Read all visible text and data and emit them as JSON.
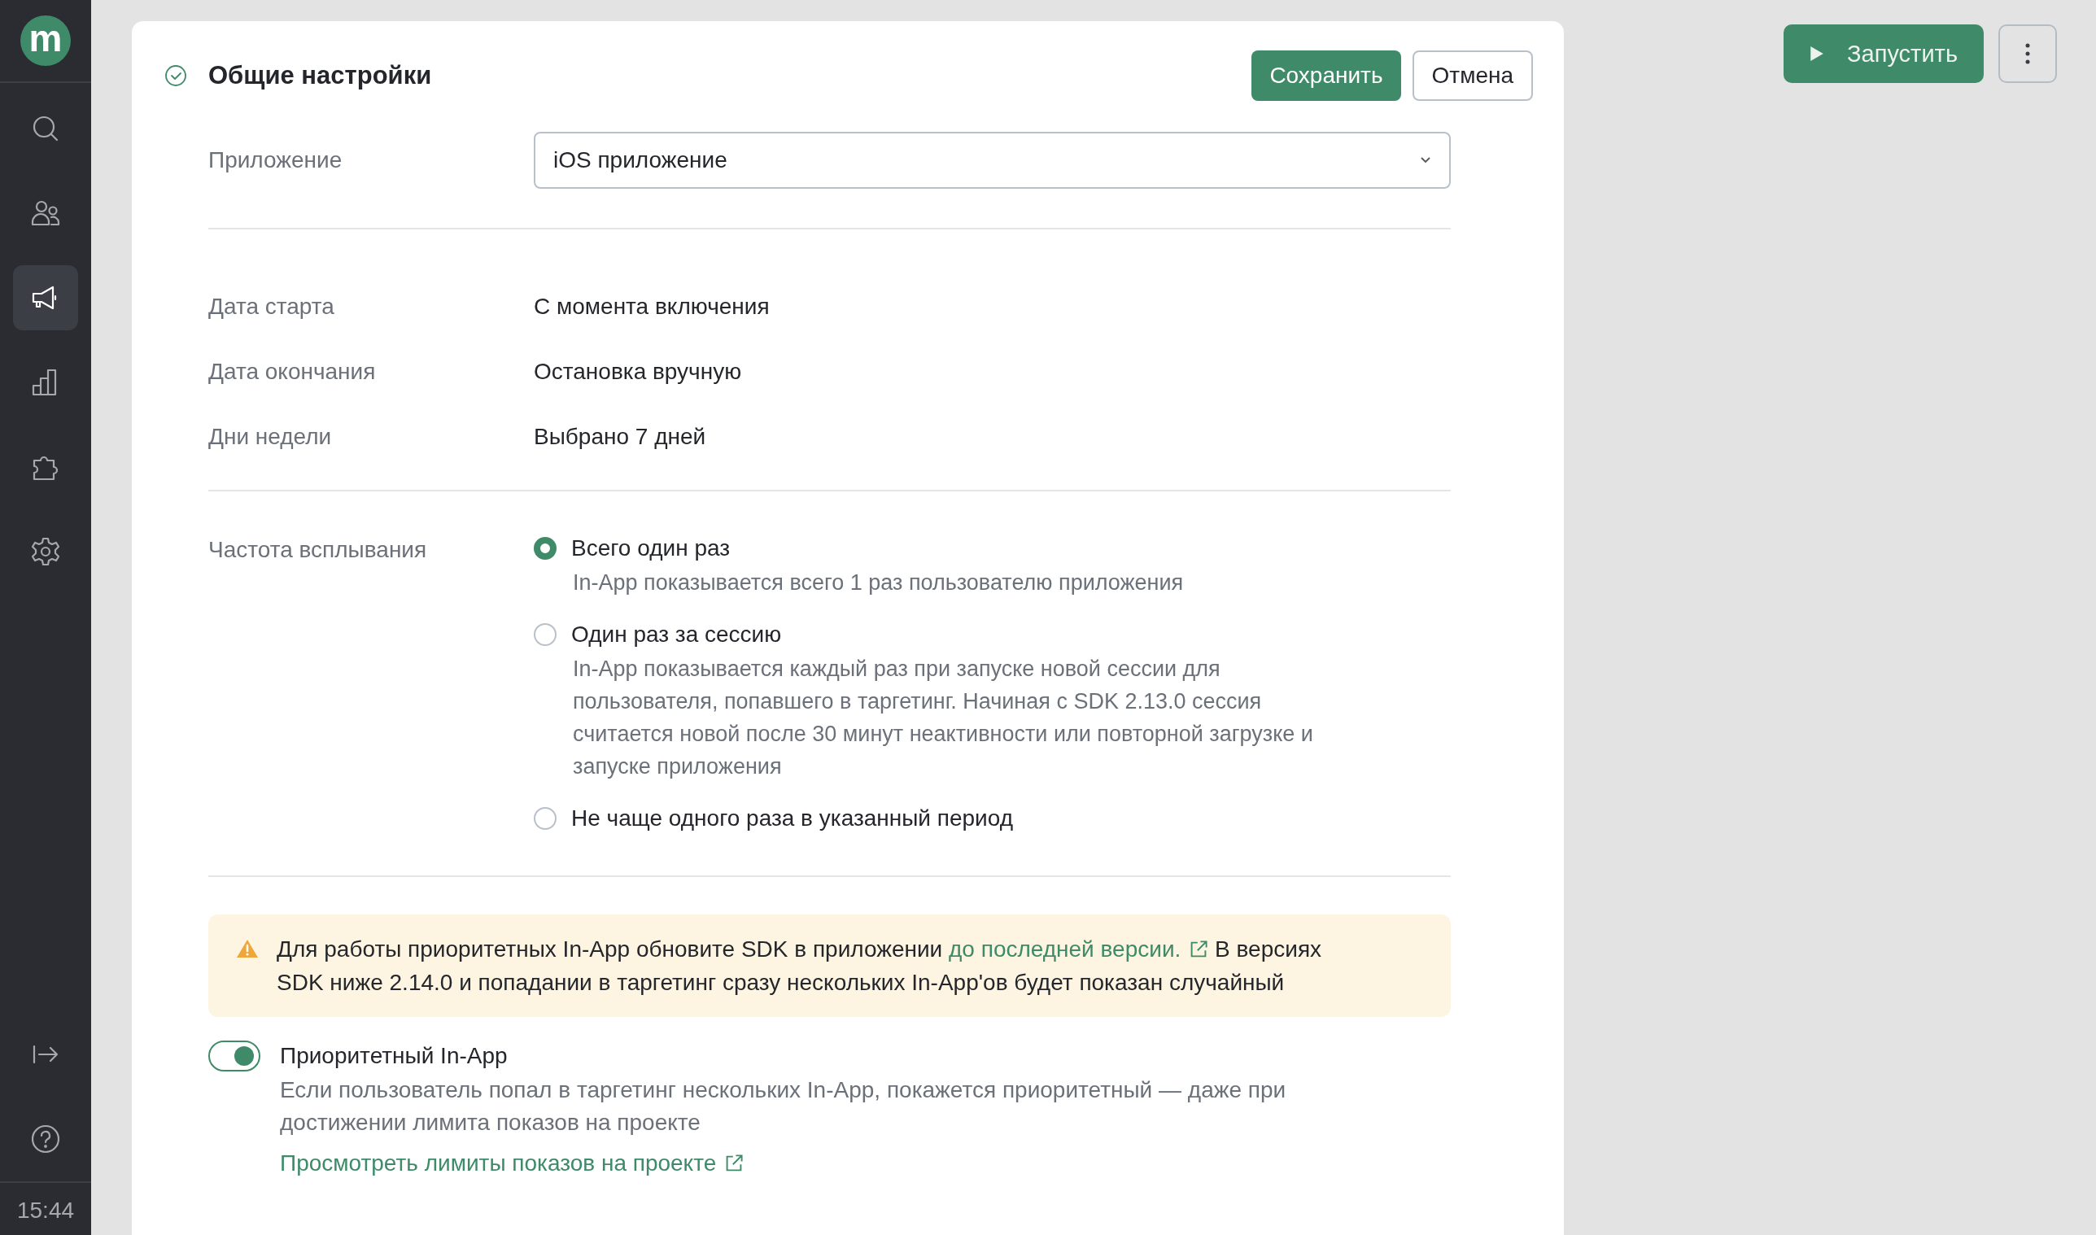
{
  "sidebar": {
    "logo": "m",
    "items": [
      {
        "kind": "search",
        "selected": false
      },
      {
        "kind": "users",
        "selected": false
      },
      {
        "kind": "megaphone",
        "selected": true
      },
      {
        "kind": "chart",
        "selected": false
      },
      {
        "kind": "puzzle",
        "selected": false
      },
      {
        "kind": "settings",
        "selected": false
      }
    ],
    "bottom_items": [
      {
        "kind": "collapse"
      },
      {
        "kind": "help"
      }
    ],
    "time": "15:44"
  },
  "panel": {
    "title": "Общие настройки",
    "save": "Сохранить",
    "cancel": "Отмена",
    "app": {
      "label": "Приложение",
      "value": "iOS приложение"
    },
    "details": [
      {
        "label": "Дата старта",
        "value": "С момента включения"
      },
      {
        "label": "Дата окончания",
        "value": "Остановка вручную"
      },
      {
        "label": "Дни недели",
        "value": "Выбрано 7 дней"
      }
    ],
    "frequency": {
      "label": "Частота всплывания",
      "options": [
        {
          "label": "Всего один раз",
          "description": "In-App показывается всего 1 раз пользователю приложения",
          "selected": true
        },
        {
          "label": "Один раз за сессию",
          "description": "In-App показывается каждый раз при запуске новой сессии для пользователя, попавшего в таргетинг. Начиная с SDK 2.13.0 сессия считается новой после 30 минут неактивности или повторной загрузке и запуске приложения",
          "selected": false
        },
        {
          "label": "Не чаще одного раза в указанный период",
          "selected": false
        }
      ]
    },
    "warning": {
      "before": "Для работы приоритетных In-App обновите SDK в приложении",
      "link": "до последней версии.",
      "after": "В версиях SDK ниже 2.14.0 и попадании в таргетинг сразу нескольких In-App'ов будет показан случайный"
    },
    "priority": {
      "label": "Приоритетный In-App",
      "on": true,
      "description": "Если пользователь попал в таргетинг нескольких In-App, покажется приоритетный — даже при достижении лимита показов на проекте",
      "link": "Просмотреть лимиты показов на проекте"
    }
  },
  "toolbar": {
    "run": "Запустить"
  }
}
